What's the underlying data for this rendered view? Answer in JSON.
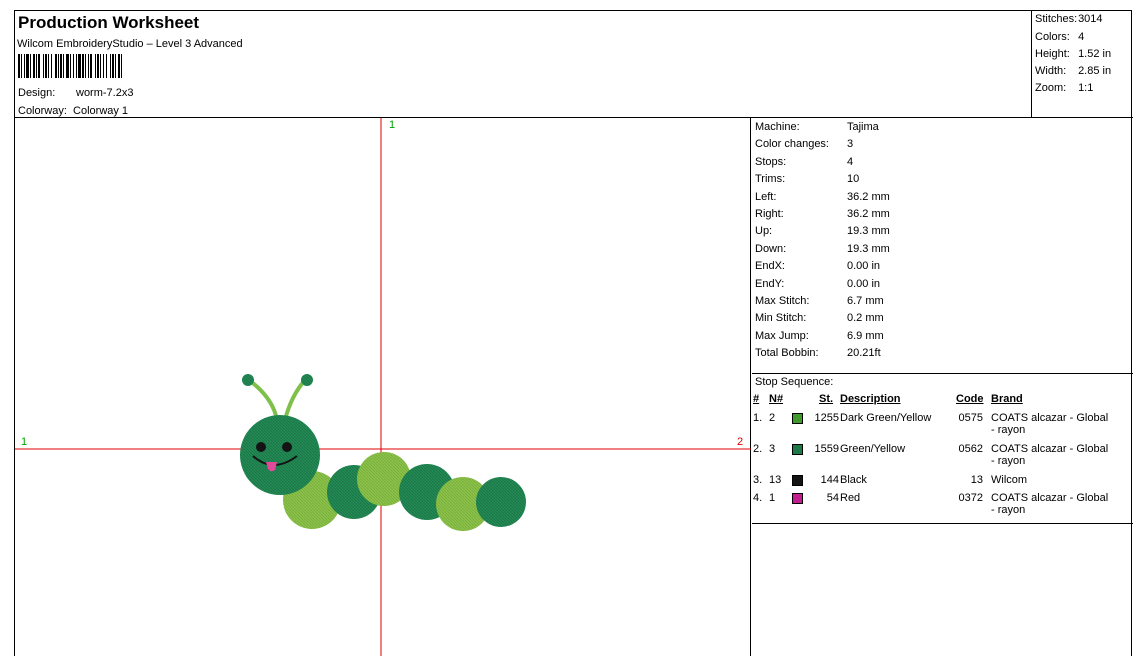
{
  "header": {
    "title": "Production Worksheet",
    "subtitle": "Wilcom EmbroideryStudio – Level 3 Advanced",
    "design_label": "Design:",
    "design_value": "worm-7.2x3",
    "colorway_label": "Colorway:",
    "colorway_value": "Colorway 1"
  },
  "summary": {
    "stitches_label": "Stitches:",
    "stitches_value": "3014",
    "colors_label": "Colors:",
    "colors_value": "4",
    "height_label": "Height:",
    "height_value": "1.52 in",
    "width_label": "Width:",
    "width_value": "2.85 in",
    "zoom_label": "Zoom:",
    "zoom_value": "1:1"
  },
  "canvas": {
    "axis_top": "1",
    "axis_left": "1",
    "axis_right": "2"
  },
  "machine_info": [
    {
      "label": "Machine:",
      "value": "Tajima"
    },
    {
      "label": "Color changes:",
      "value": "3"
    },
    {
      "label": "Stops:",
      "value": "4"
    },
    {
      "label": "Trims:",
      "value": "10"
    },
    {
      "label": "Left:",
      "value": "36.2 mm"
    },
    {
      "label": "Right:",
      "value": "36.2 mm"
    },
    {
      "label": "Up:",
      "value": "19.3 mm"
    },
    {
      "label": "Down:",
      "value": "19.3 mm"
    },
    {
      "label": "EndX:",
      "value": "0.00 in"
    },
    {
      "label": "EndY:",
      "value": "0.00 in"
    },
    {
      "label": "Max Stitch:",
      "value": "6.7 mm"
    },
    {
      "label": "Min Stitch:",
      "value": "0.2 mm"
    },
    {
      "label": "Max Jump:",
      "value": "6.9 mm"
    },
    {
      "label": "Total Bobbin:",
      "value": "20.21ft"
    }
  ],
  "stop_sequence": {
    "title": "Stop Sequence:",
    "headers": {
      "num": "#",
      "n": "N#",
      "st": "St.",
      "description": "Description",
      "code": "Code",
      "brand": "Brand"
    },
    "rows": [
      {
        "num": "1.",
        "n": "2",
        "color": "#3f9a2c",
        "st": "1255",
        "description": "Dark Green/Yellow",
        "code": "0575",
        "brand": "COATS alcazar - Global",
        "brand2": "- rayon"
      },
      {
        "num": "2.",
        "n": "3",
        "color": "#1d7a48",
        "st": "1559",
        "description": "Green/Yellow",
        "code": "0562",
        "brand": "COATS alcazar - Global",
        "brand2": "- rayon"
      },
      {
        "num": "3.",
        "n": "13",
        "color": "#141414",
        "st": "144",
        "description": "Black",
        "code": "13",
        "brand": "Wilcom",
        "brand2": ""
      },
      {
        "num": "4.",
        "n": "1",
        "color": "#c21d8e",
        "st": "54",
        "description": "Red",
        "code": "0372",
        "brand": "COATS alcazar - Global",
        "brand2": "- rayon"
      }
    ]
  },
  "colors": {
    "crosshair": "#e00000",
    "axis_top_label": "#00a000",
    "axis_left_label": "#00a000",
    "axis_right_label": "#e00000",
    "worm_dark": "#228a55",
    "worm_light": "#8cc24a",
    "antenna": "#7fc04b"
  }
}
